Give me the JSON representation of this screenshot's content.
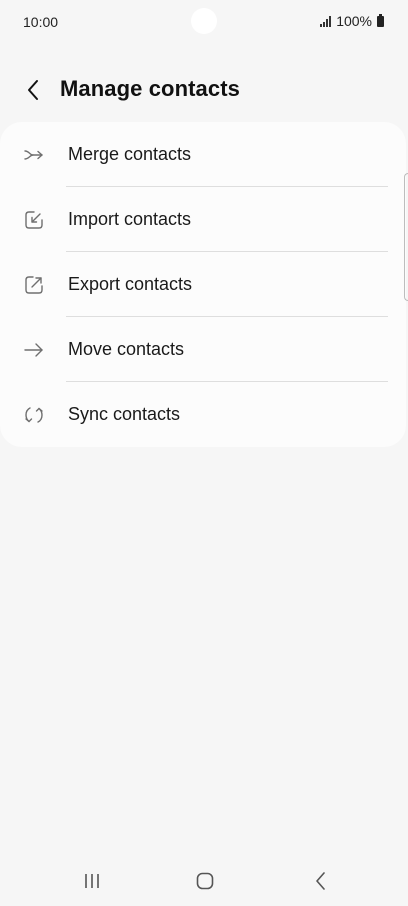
{
  "status_bar": {
    "time": "10:00",
    "battery": "100%"
  },
  "header": {
    "title": "Manage contacts",
    "back_icon": "back-arrow-icon"
  },
  "menu": {
    "items": [
      {
        "label": "Merge contacts",
        "icon": "merge-icon"
      },
      {
        "label": "Import contacts",
        "icon": "import-icon"
      },
      {
        "label": "Export contacts",
        "icon": "export-icon"
      },
      {
        "label": "Move contacts",
        "icon": "move-arrow-icon"
      },
      {
        "label": "Sync contacts",
        "icon": "sync-icon"
      }
    ]
  },
  "nav_bar": {
    "recents_icon": "recent-apps-icon",
    "home_icon": "home-icon",
    "back_icon": "nav-back-icon"
  },
  "colors": {
    "background": "#f6f6f6",
    "card": "#fcfcfc",
    "icon_gray": "#6f6f6f",
    "text": "#1a1a1a"
  }
}
